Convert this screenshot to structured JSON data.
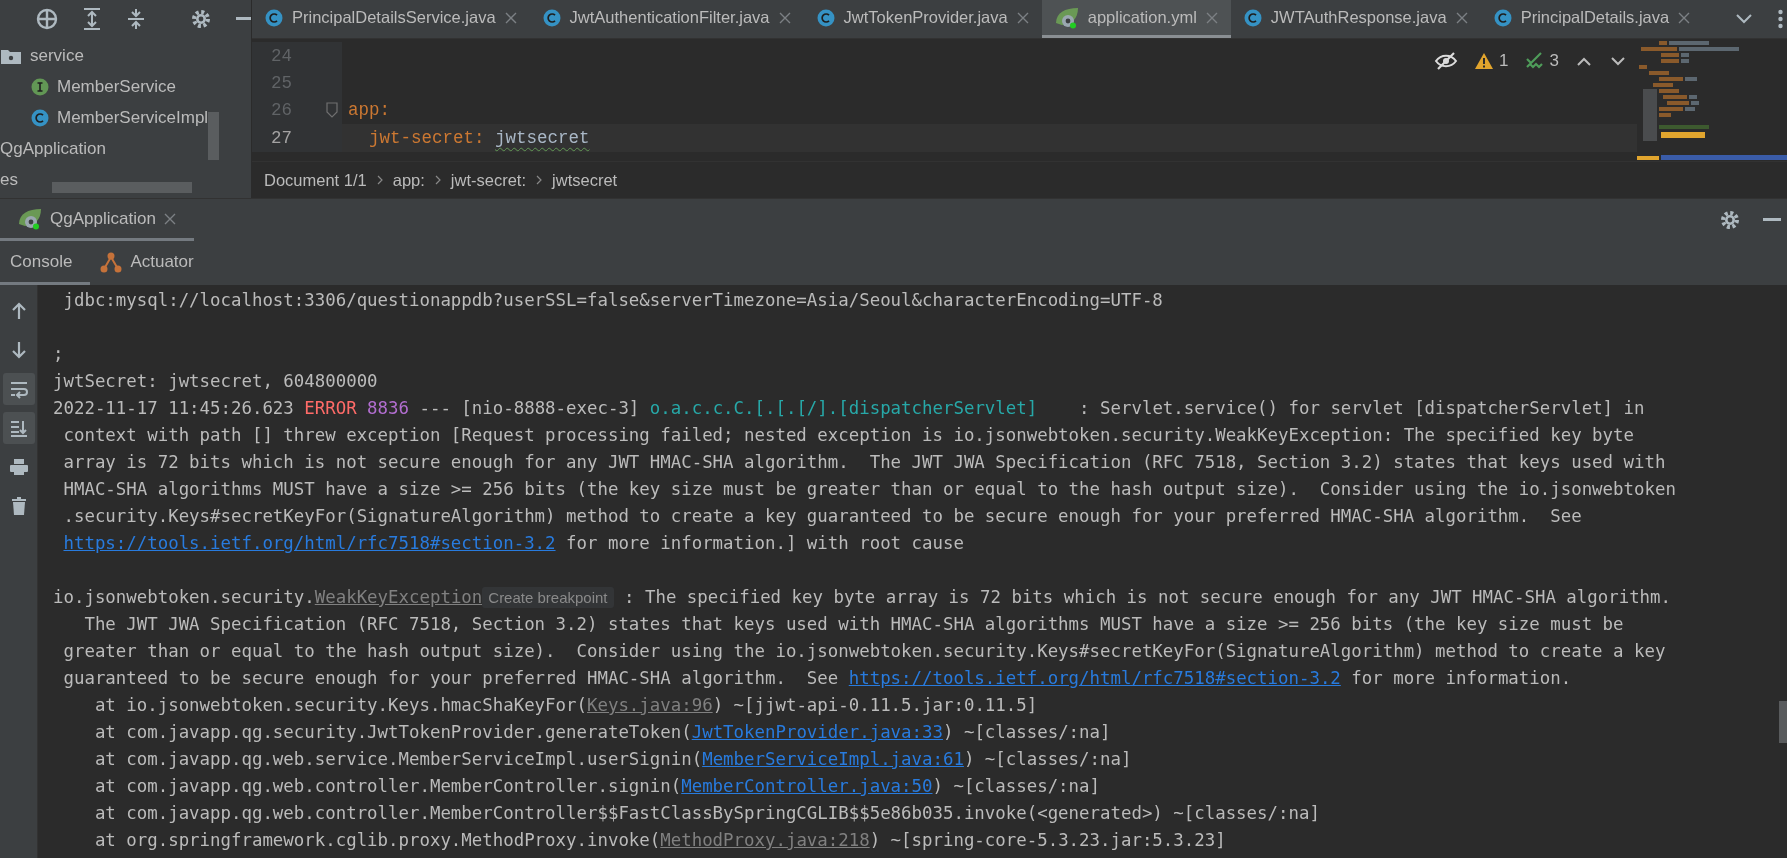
{
  "project_panel": {
    "tree": [
      {
        "label": "service",
        "kind": "folder",
        "children": [
          {
            "label": "MemberService",
            "kind": "interface"
          },
          {
            "label": "MemberServiceImpl",
            "kind": "class"
          }
        ]
      },
      {
        "label": "QgApplication",
        "kind": "plain"
      },
      {
        "label": "es",
        "kind": "plain"
      }
    ]
  },
  "editor": {
    "tabs": [
      {
        "label": "PrincipalDetailsService.java",
        "kind": "class",
        "selected": false
      },
      {
        "label": "JwtAuthenticationFilter.java",
        "kind": "class",
        "selected": false
      },
      {
        "label": "JwtTokenProvider.java",
        "kind": "class",
        "selected": false
      },
      {
        "label": "application.yml",
        "kind": "spring",
        "selected": true
      },
      {
        "label": "JWTAuthResponse.java",
        "kind": "class",
        "selected": false
      },
      {
        "label": "PrincipalDetails.java",
        "kind": "class",
        "selected": false
      }
    ],
    "inspections": {
      "warnings": "1",
      "checks": "3"
    },
    "lines": [
      {
        "number": "24"
      },
      {
        "number": "25"
      },
      {
        "number": "26",
        "key": "app:",
        "children": [
          {
            "number": "27",
            "key": "jwt-secret:",
            "value": "jwtsecret",
            "current": true,
            "typo": true
          }
        ]
      }
    ],
    "breadcrumb": [
      "Document 1/1",
      "app:",
      "jwt-secret:",
      "jwtsecret"
    ]
  },
  "run_panel": {
    "tabs": [
      {
        "label": "QgApplication",
        "selected": true
      }
    ],
    "console_tabs": [
      {
        "label": "Console",
        "kind": "plain",
        "selected": true
      },
      {
        "label": "Actuator",
        "kind": "actuator",
        "selected": false
      }
    ],
    "toolbar": [
      {
        "kind": "up",
        "on": false
      },
      {
        "kind": "down",
        "on": false
      },
      {
        "kind": "wrap",
        "on": true
      },
      {
        "kind": "scroll_end",
        "on": true
      },
      {
        "kind": "print",
        "on": false
      },
      {
        "kind": "trash",
        "on": false
      }
    ],
    "console": [
      {
        "lines": [
          {
            "continuation": true,
            "segments": [
              {
                "kind": "text",
                "text": "jdbc:mysql://localhost:3306/questionappdb?userSSL=false&serverTimezone=Asia/Seoul&characterEncoding=UTF-8"
              }
            ]
          }
        ]
      },
      {
        "lines": [
          {
            "continuation": false,
            "segments": [
              {
                "kind": "text",
                "text": ";"
              }
            ]
          },
          {
            "continuation": false,
            "segments": [
              {
                "kind": "text",
                "text": "jwtSecret: jwtsecret, 604800000"
              }
            ]
          },
          {
            "continuation": false,
            "segments": [
              {
                "kind": "text",
                "text": "2022-11-17 11:45:26.623 "
              },
              {
                "kind": "error",
                "text": "ERROR"
              },
              {
                "kind": "pid",
                "text": " 8836"
              },
              {
                "kind": "text",
                "text": " --- [nio-8888-exec-3] "
              },
              {
                "kind": "logger",
                "text": "o.a.c.c.C.[.[.[/].[dispatcherServlet]"
              },
              {
                "kind": "text",
                "text": "    : Servlet.service() for servlet [dispatcherServlet] in"
              }
            ]
          },
          {
            "continuation": true,
            "segments": [
              {
                "kind": "text",
                "text": "context with path [] threw exception [Request processing failed; nested exception is io.jsonwebtoken.security.WeakKeyException: The specified key byte"
              }
            ]
          },
          {
            "continuation": true,
            "segments": [
              {
                "kind": "text",
                "text": "array is 72 bits which is not secure enough for any JWT HMAC-SHA algorithm.  The JWT JWA Specification (RFC 7518, Section 3.2) states that keys used with"
              }
            ]
          },
          {
            "continuation": true,
            "segments": [
              {
                "kind": "text",
                "text": "HMAC-SHA algorithms MUST have a size >= 256 bits (the key size must be greater than or equal to the hash output size).  Consider using the io.jsonwebtoken"
              }
            ]
          },
          {
            "continuation": true,
            "segments": [
              {
                "kind": "text",
                "text": ".security.Keys#secretKeyFor(SignatureAlgorithm) method to create a key guaranteed to be secure enough for your preferred HMAC-SHA algorithm.  See"
              }
            ]
          },
          {
            "continuation": true,
            "segments": [
              {
                "kind": "link",
                "text": "https://tools.ietf.org/html/rfc7518#section-3.2"
              },
              {
                "kind": "text",
                "text": " for more information.] with root cause"
              }
            ]
          }
        ]
      },
      {
        "lines": [
          {
            "continuation": false,
            "segments": [
              {
                "kind": "text",
                "text": "io.jsonwebtoken.security."
              },
              {
                "kind": "source",
                "text": "WeakKeyException"
              },
              {
                "kind": "hint",
                "text": "Create breakpoint"
              },
              {
                "kind": "text",
                "text": " : The specified key byte array is 72 bits which is not secure enough for any JWT HMAC-SHA algorithm."
              }
            ]
          },
          {
            "continuation": true,
            "segments": [
              {
                "kind": "text",
                "text": "  The JWT JWA Specification (RFC 7518, Section 3.2) states that keys used with HMAC-SHA algorithms MUST have a size >= 256 bits (the key size must be"
              }
            ]
          },
          {
            "continuation": true,
            "segments": [
              {
                "kind": "text",
                "text": "greater than or equal to the hash output size).  Consider using the io.jsonwebtoken.security.Keys#secretKeyFor(SignatureAlgorithm) method to create a key"
              }
            ]
          },
          {
            "continuation": true,
            "segments": [
              {
                "kind": "text",
                "text": "guaranteed to be secure enough for your preferred HMAC-SHA algorithm.  See "
              },
              {
                "kind": "link",
                "text": "https://tools.ietf.org/html/rfc7518#section-3.2"
              },
              {
                "kind": "text",
                "text": " for more information."
              }
            ]
          },
          {
            "continuation": false,
            "segments": [
              {
                "kind": "text",
                "text": "    at io.jsonwebtoken.security.Keys.hmacShaKeyFor("
              },
              {
                "kind": "source",
                "text": "Keys.java:96"
              },
              {
                "kind": "text",
                "text": ") ~[jjwt-api-0.11.5.jar:0.11.5]"
              }
            ]
          },
          {
            "continuation": false,
            "segments": [
              {
                "kind": "text",
                "text": "    at com.javapp.qg.security.JwtTokenProvider.generateToken("
              },
              {
                "kind": "link",
                "text": "JwtTokenProvider.java:33"
              },
              {
                "kind": "text",
                "text": ") ~[classes/:na]"
              }
            ]
          },
          {
            "continuation": false,
            "segments": [
              {
                "kind": "text",
                "text": "    at com.javapp.qg.web.service.MemberServiceImpl.userSignin("
              },
              {
                "kind": "link",
                "text": "MemberServiceImpl.java:61"
              },
              {
                "kind": "text",
                "text": ") ~[classes/:na]"
              }
            ]
          },
          {
            "continuation": false,
            "segments": [
              {
                "kind": "text",
                "text": "    at com.javapp.qg.web.controller.MemberController.signin("
              },
              {
                "kind": "link",
                "text": "MemberController.java:50"
              },
              {
                "kind": "text",
                "text": ") ~[classes/:na]"
              }
            ]
          },
          {
            "continuation": false,
            "segments": [
              {
                "kind": "text",
                "text": "    at com.javapp.qg.web.controller.MemberController$$FastClassBySpringCGLIB$$5e86b035.invoke(<generated>) ~[classes/:na]"
              }
            ]
          },
          {
            "continuation": false,
            "segments": [
              {
                "kind": "text",
                "text": "    at org.springframework.cglib.proxy.MethodProxy.invoke("
              },
              {
                "kind": "source",
                "text": "MethodProxy.java:218"
              },
              {
                "kind": "text",
                "text": ") ~[spring-core-5.3.23.jar:5.3.23]"
              }
            ]
          }
        ]
      }
    ]
  }
}
